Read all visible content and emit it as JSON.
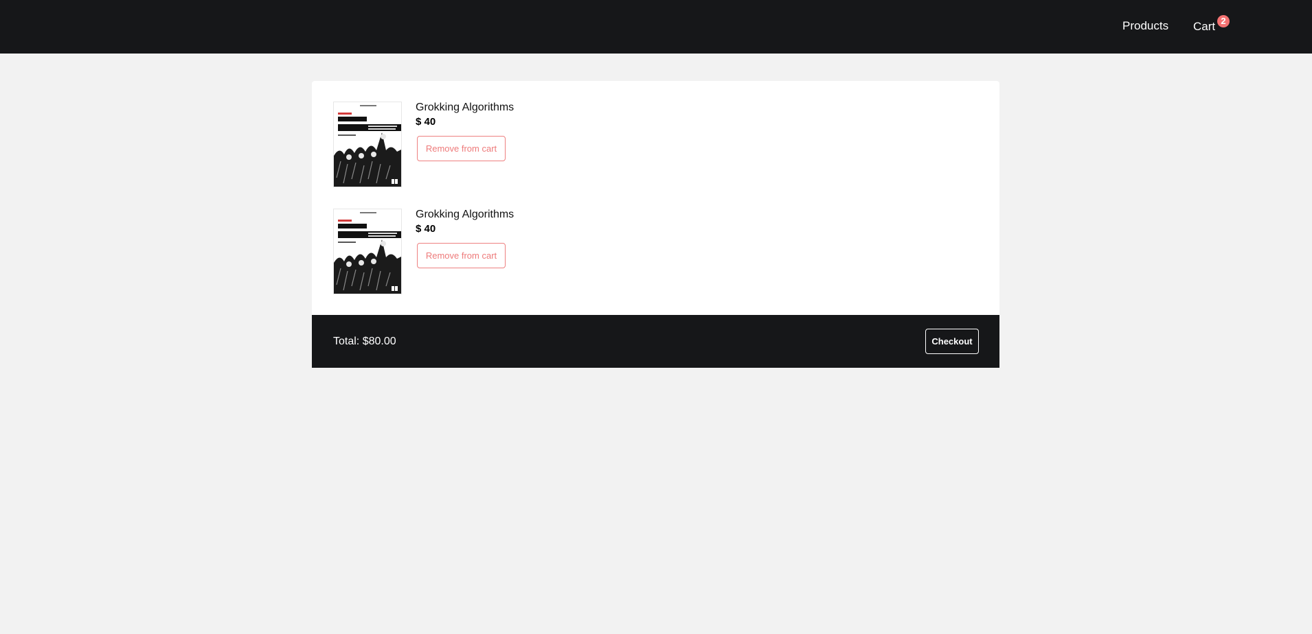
{
  "nav": {
    "products_label": "Products",
    "cart_label": "Cart",
    "cart_count": "2",
    "badge_color": "#f47272"
  },
  "cart": {
    "items": [
      {
        "title": "Grokking Algorithms",
        "price": "$ 40",
        "remove_label": "Remove from cart",
        "cover_icon": "book-cover-image"
      },
      {
        "title": "Grokking Algorithms",
        "price": "$ 40",
        "remove_label": "Remove from cart",
        "cover_icon": "book-cover-image"
      }
    ],
    "total_label": "Total: $80.00",
    "checkout_label": "Checkout"
  },
  "colors": {
    "dark": "#161719",
    "background": "#f2f2f2",
    "accent": "#ee7a7a"
  }
}
